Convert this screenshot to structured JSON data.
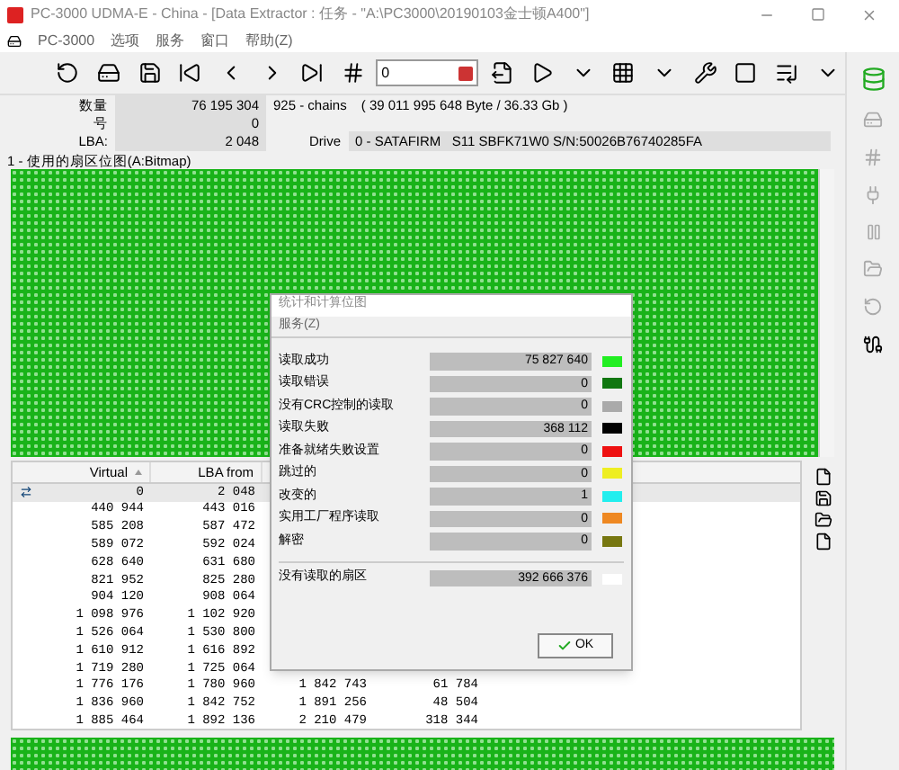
{
  "window": {
    "title": "PC-3000 UDMA-E - China - [Data Extractor : 任务 - \"A:\\PC3000\\20190103金士顿A400\"]",
    "menu": [
      "PC-3000",
      "选项",
      "服务",
      "窗口",
      "帮助(Z)"
    ]
  },
  "toolbar": {
    "position_field": {
      "value": "0"
    }
  },
  "info": {
    "count_label": "数量",
    "count_value": "76 195 304",
    "chains": "925 - chains",
    "size": "( 39 011 995 648 Byte / 36.33 Gb )",
    "number_label": "号",
    "number_value": "0",
    "lba_label": "LBA:",
    "lba_value": "2 048",
    "drive_label": "Drive",
    "drive_value": "0 - SATAFIRM   S11 SBFK71W0 S/N:50026B76740285FA"
  },
  "bitmap": {
    "title": "1 - 使用的扇区位图(A:Bitmap)"
  },
  "table": {
    "columns": [
      "Virtual",
      "LBA from"
    ],
    "rows": [
      {
        "cells": [
          "0",
          "2 048"
        ],
        "selected": true
      },
      {
        "cells": [
          "440 944",
          "443 016"
        ],
        "selected": false
      },
      {
        "cells": [
          "585 208",
          "587 472"
        ],
        "selected": false
      },
      {
        "cells": [
          "589 072",
          "592 024"
        ],
        "selected": false
      },
      {
        "cells": [
          "628 640",
          "631 680"
        ],
        "selected": false
      },
      {
        "cells": [
          "821 952",
          "825 280"
        ],
        "selected": false
      },
      {
        "cells": [
          "904 120",
          "908 064"
        ],
        "selected": false
      },
      {
        "cells": [
          "1 098 976",
          "1 102 920"
        ],
        "selected": false
      },
      {
        "cells": [
          "1 526 064",
          "1 530 800"
        ],
        "selected": false
      },
      {
        "cells": [
          "1 610 912",
          "1 616 892"
        ],
        "selected": false
      },
      {
        "cells": [
          "1 719 280",
          "1 725 064"
        ],
        "selected": false
      },
      {
        "cells": [
          "1 776 176",
          "1 780 960",
          "1 842 743",
          "61 784"
        ],
        "selected": false
      },
      {
        "cells": [
          "1 836 960",
          "1 842 752",
          "1 891 256",
          "48 504"
        ],
        "selected": false
      },
      {
        "cells": [
          "1 885 464",
          "1 892 136",
          "2 210 479",
          "318 344"
        ],
        "selected": false
      }
    ]
  },
  "dialog": {
    "title": "统计和计算位图",
    "menu": "服务(Z)",
    "rows": [
      {
        "label": "读取成功",
        "value": "75 827 640",
        "color": "#22ee22"
      },
      {
        "label": "读取错误",
        "value": "0",
        "color": "#117711"
      },
      {
        "label": "没有CRC控制的读取",
        "value": "0",
        "color": "#aaaaaa"
      },
      {
        "label": "读取失败",
        "value": "368 112",
        "color": "#000000"
      },
      {
        "label": "准备就绪失败设置",
        "value": "0",
        "color": "#ee1111"
      },
      {
        "label": "跳过的",
        "value": "0",
        "color": "#eeee22"
      },
      {
        "label": "改变的",
        "value": "1",
        "color": "#22eeee"
      },
      {
        "label": "实用工厂程序读取",
        "value": "0",
        "color": "#ee8822"
      },
      {
        "label": "解密",
        "value": "0",
        "color": "#777711"
      }
    ],
    "unread": {
      "label": "没有读取的扇区",
      "value": "392 666 376",
      "color": "#ffffff"
    },
    "ok": "OK"
  }
}
